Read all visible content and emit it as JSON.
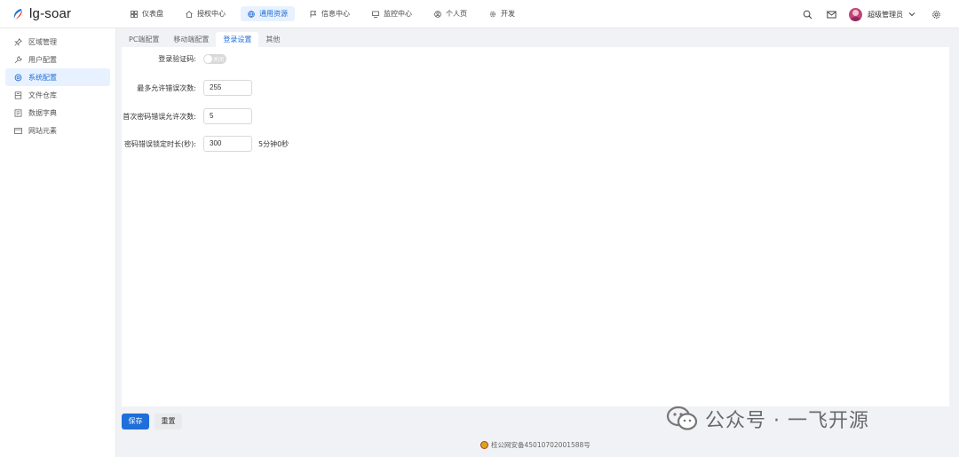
{
  "app": {
    "logo_text": "lg-soar"
  },
  "nav": {
    "items": [
      {
        "label": "仪表盘",
        "icon": "grid-icon"
      },
      {
        "label": "授权中心",
        "icon": "home-icon"
      },
      {
        "label": "通用资源",
        "icon": "globe-icon",
        "active": true
      },
      {
        "label": "信息中心",
        "icon": "flag-icon"
      },
      {
        "label": "监控中心",
        "icon": "monitor-icon"
      },
      {
        "label": "个人页",
        "icon": "user-circle-icon"
      },
      {
        "label": "开发",
        "icon": "gear-icon"
      }
    ]
  },
  "header": {
    "user_name": "超级管理员"
  },
  "sidebar": {
    "items": [
      {
        "label": "区域管理",
        "icon": "pin-icon"
      },
      {
        "label": "用户配置",
        "icon": "wrench-icon"
      },
      {
        "label": "系统配置",
        "icon": "settings-icon",
        "active": true
      },
      {
        "label": "文件仓库",
        "icon": "storage-icon"
      },
      {
        "label": "数据字典",
        "icon": "book-icon"
      },
      {
        "label": "网站元素",
        "icon": "window-icon"
      }
    ]
  },
  "tabs": [
    {
      "label": "PC端配置"
    },
    {
      "label": "移动端配置"
    },
    {
      "label": "登录设置",
      "active": true
    },
    {
      "label": "其他"
    }
  ],
  "form": {
    "captcha": {
      "label": "登录验证码:",
      "state_text": "关闭",
      "enabled": false
    },
    "max_errors": {
      "label": "最多允许错误次数:",
      "value": "255"
    },
    "first_errors": {
      "label": "首次密码错误允许次数:",
      "value": "5"
    },
    "lock_duration": {
      "label": "密码错误锁定时长(秒):",
      "value": "300",
      "suffix": "5分钟0秒"
    }
  },
  "actions": {
    "save_label": "保存",
    "reset_label": "重置"
  },
  "footer": {
    "icp_text": "桂公网安备45010702001588号"
  },
  "watermark": {
    "text": "公众号 · 一飞开源"
  },
  "colors": {
    "accent": "#1e6fd9",
    "active_bg": "#e8f1ff"
  }
}
